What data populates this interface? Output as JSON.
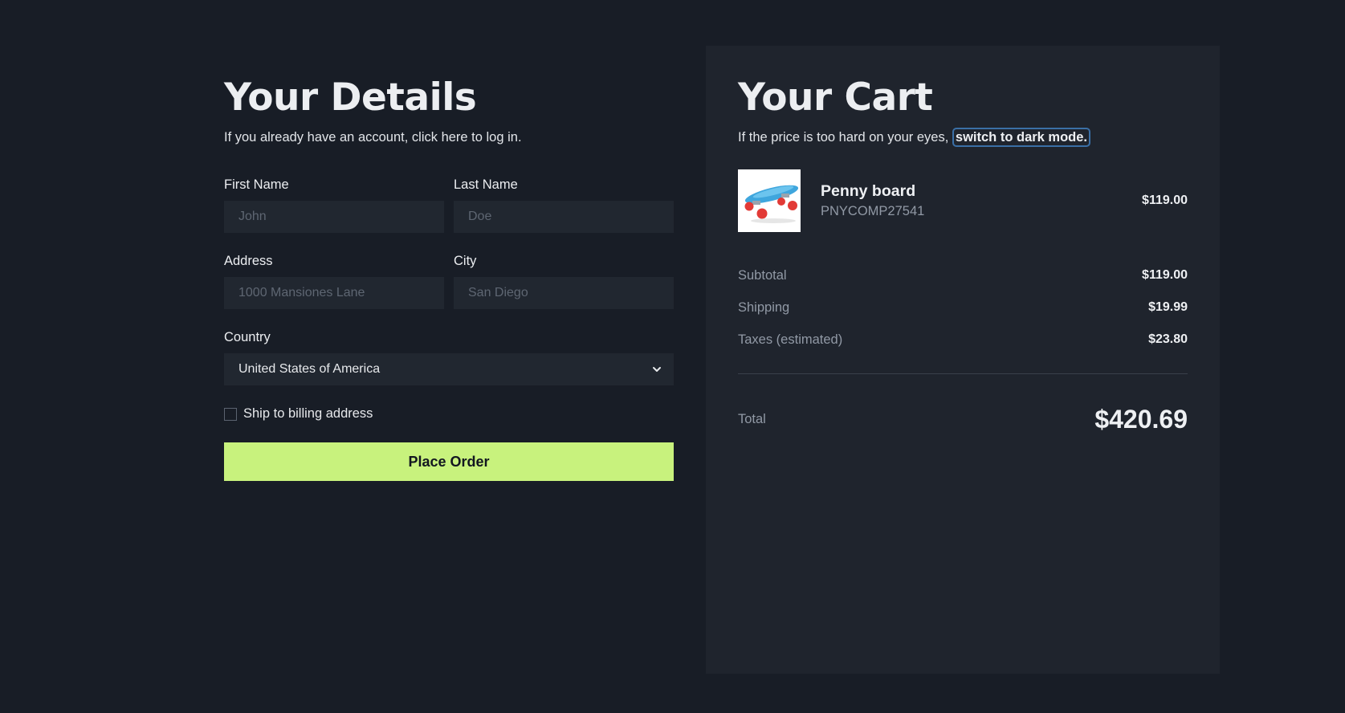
{
  "details": {
    "title": "Your Details",
    "subtitle": "If you already have an account, click here to log in.",
    "first_name": {
      "label": "First Name",
      "placeholder": "John"
    },
    "last_name": {
      "label": "Last Name",
      "placeholder": "Doe"
    },
    "address": {
      "label": "Address",
      "placeholder": "1000 Mansiones Lane"
    },
    "city": {
      "label": "City",
      "placeholder": "San Diego"
    },
    "country": {
      "label": "Country",
      "value": "United States of America"
    },
    "ship_checkbox_label": "Ship to billing address",
    "ship_checkbox_checked": false,
    "place_order_label": "Place Order"
  },
  "cart": {
    "title": "Your Cart",
    "subtitle_prefix": "If the price is too hard on your eyes,",
    "dark_mode_link": "switch to dark mode.",
    "product": {
      "name": "Penny board",
      "sku": "PNYCOMP27541",
      "price": "$119.00",
      "image_icon": "skateboard-image"
    },
    "summary": [
      {
        "label": "Subtotal",
        "value": "$119.00"
      },
      {
        "label": "Shipping",
        "value": "$19.99"
      },
      {
        "label": "Taxes (estimated)",
        "value": "$23.80"
      }
    ],
    "total_label": "Total",
    "total_value": "$420.69"
  },
  "colors": {
    "background": "#181d26",
    "panel": "#1f242d",
    "accent": "#c8f27d",
    "focus_ring": "#3a6fa6"
  }
}
